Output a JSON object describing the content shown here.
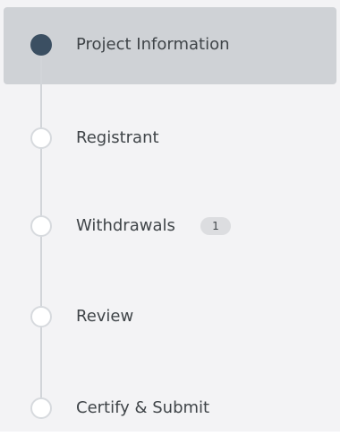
{
  "steps": [
    {
      "label": "Project Information",
      "state": "current"
    },
    {
      "label": "Registrant",
      "state": "pending"
    },
    {
      "label": "Withdrawals",
      "state": "pending",
      "badge": "1"
    },
    {
      "label": "Review",
      "state": "pending"
    },
    {
      "label": "Certify & Submit",
      "state": "pending"
    }
  ],
  "colors": {
    "active_background": "#cfd2d6",
    "current_dot": "#3b4f62",
    "rail": "#d2d5d9",
    "text": "#3f4448"
  }
}
